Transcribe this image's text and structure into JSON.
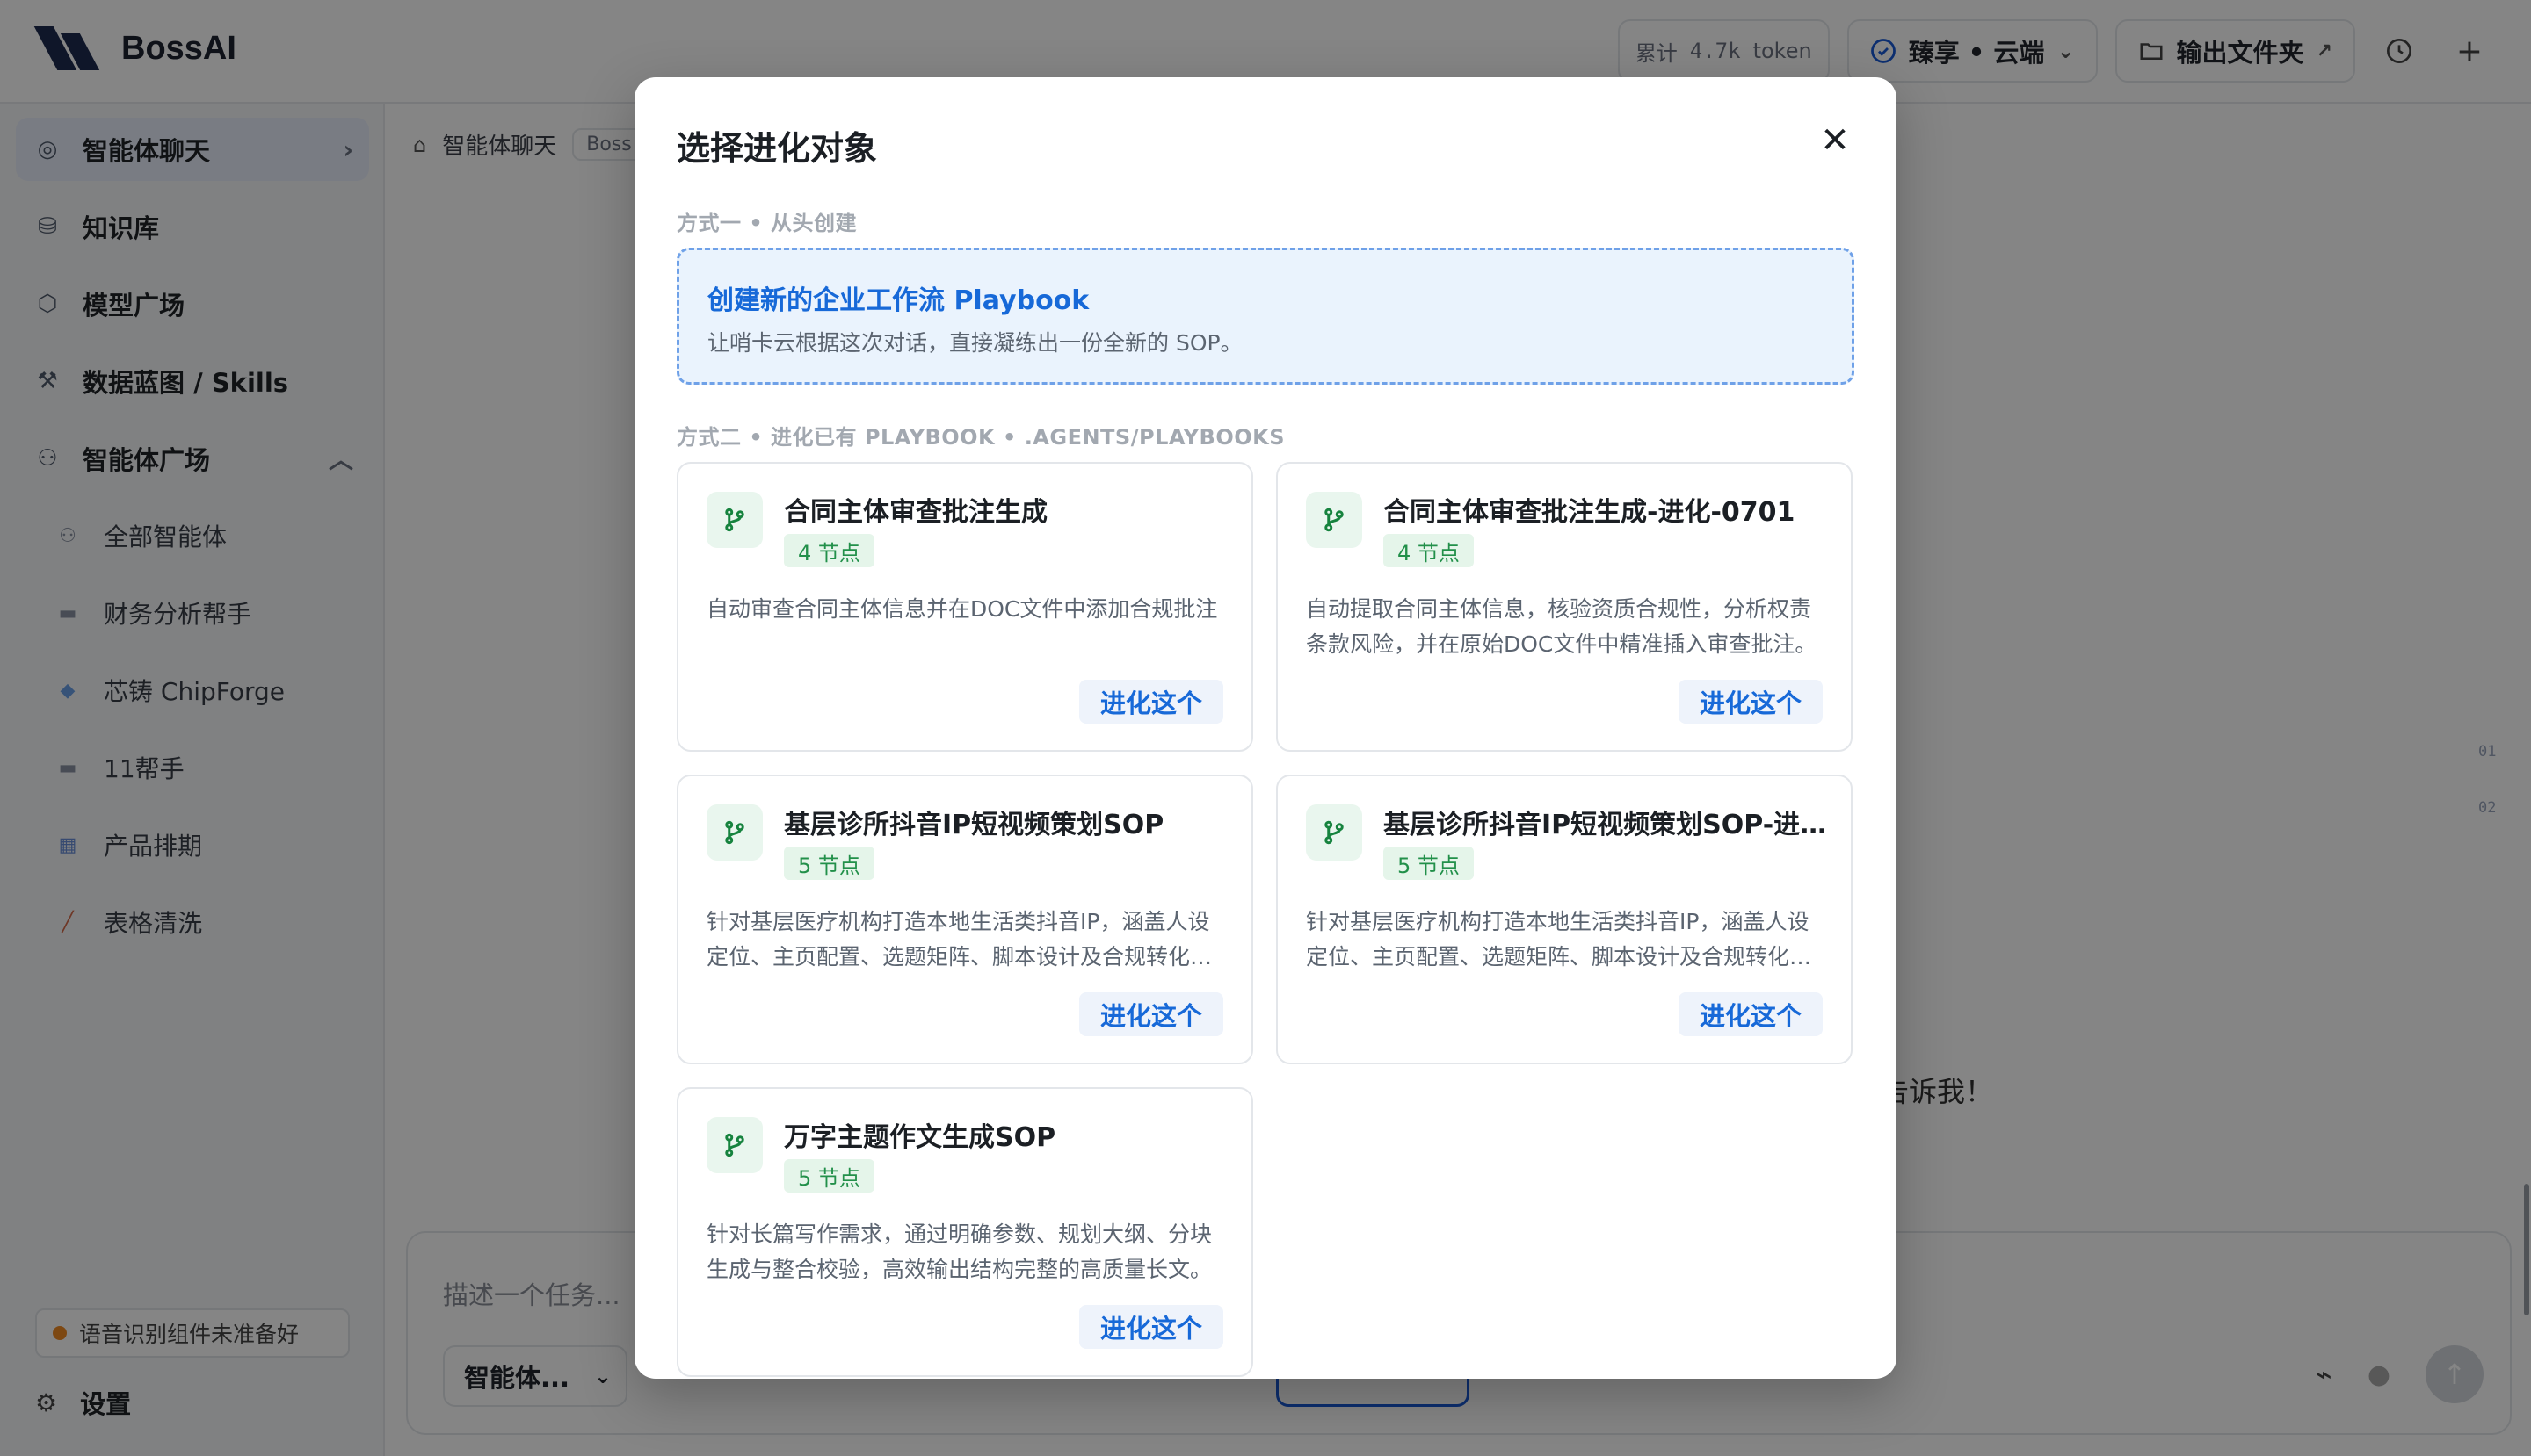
{
  "app": {
    "name": "BossAI",
    "token_label": "累计",
    "token_value": "4.7k",
    "token_unit": "token",
    "model_pill": "臻享 • 云端",
    "output_folder": "输出文件夹"
  },
  "sidebar": {
    "items": [
      {
        "label": "智能体聊天",
        "icon": "compass-icon"
      },
      {
        "label": "知识库",
        "icon": "database-icon"
      },
      {
        "label": "模型广场",
        "icon": "cube-icon"
      },
      {
        "label": "数据蓝图 / Skills",
        "icon": "wrench-icon"
      },
      {
        "label": "智能体广场",
        "icon": "users-icon"
      }
    ],
    "sub_items": [
      {
        "label": "全部智能体"
      },
      {
        "label": "财务分析帮手"
      },
      {
        "label": "芯铸 ChipForge"
      },
      {
        "label": "11帮手"
      },
      {
        "label": "产品排期"
      },
      {
        "label": "表格清洗"
      }
    ],
    "voice_warning": "语音识别组件未准备好",
    "settings": "设置"
  },
  "main": {
    "breadcrumb": "智能体聊天",
    "breadcrumb_tag": "Boss",
    "behind_text": "告诉我！",
    "line_numbers": [
      "01",
      "02"
    ],
    "composer": {
      "placeholder": "描述一个任务...",
      "agent_select": "智能体..."
    }
  },
  "modal": {
    "title": "选择进化对象",
    "section1_label": "方式一 • 从头创建",
    "create": {
      "title": "创建新的企业工作流 Playbook",
      "desc": "让哨卡云根据这次对话，直接凝练出一份全新的 SOP。"
    },
    "section2_label": "方式二 • 进化已有 PLAYBOOK • .AGENTS/PLAYBOOKS",
    "cards": [
      {
        "title": "合同主体审查批注生成",
        "badge": "4 节点",
        "desc": "自动审查合同主体信息并在DOC文件中添加合规批注",
        "button": "进化这个"
      },
      {
        "title": "合同主体审查批注生成-进化-0701",
        "badge": "4 节点",
        "desc": "自动提取合同主体信息，核验资质合规性，分析权责条款风险，并在原始DOC文件中精准插入审查批注。",
        "button": "进化这个"
      },
      {
        "title": "基层诊所抖音IP短视频策划SOP",
        "badge": "5 节点",
        "desc": "针对基层医疗机构打造本地生活类抖音IP，涵盖人设定位、主页配置、选题矩阵、脚本设计及合规转化全流程。",
        "button": "进化这个"
      },
      {
        "title": "基层诊所抖音IP短视频策划SOP-进化-...",
        "badge": "5 节点",
        "desc": "针对基层医疗机构打造本地生活类抖音IP，涵盖人设定位、主页配置、选题矩阵、脚本设计及合规转化全流程。",
        "button": "进化这个"
      },
      {
        "title": "万字主题作文生成SOP",
        "badge": "5 节点",
        "desc": "针对长篇写作需求，通过明确参数、规划大纲、分块生成与整合校验，高效输出结构完整的高质量长文。",
        "button": "进化这个"
      }
    ]
  },
  "colors": {
    "accent": "#1769d8",
    "badge_green": "#22904a",
    "overlay": "rgba(0,0,0,0.48)"
  }
}
